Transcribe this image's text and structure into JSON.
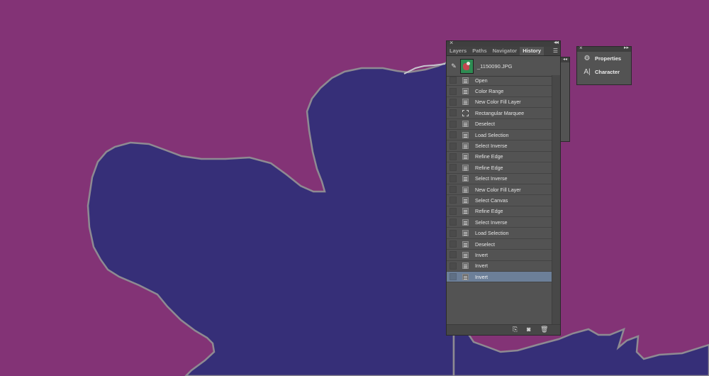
{
  "history_panel": {
    "tabs": [
      "Layers",
      "Paths",
      "Navigator",
      "History"
    ],
    "active_tab": "History",
    "snapshot_name": "_1150090.JPG",
    "items": [
      {
        "label": "Open",
        "icon": "history-state-icon"
      },
      {
        "label": "Color Range",
        "icon": "history-state-icon"
      },
      {
        "label": "New Color Fill Layer",
        "icon": "history-state-icon"
      },
      {
        "label": "Rectangular Marquee",
        "icon": "marquee-icon"
      },
      {
        "label": "Deselect",
        "icon": "history-state-icon"
      },
      {
        "label": "Load Selection",
        "icon": "history-state-icon"
      },
      {
        "label": "Select Inverse",
        "icon": "history-state-icon"
      },
      {
        "label": "Refine Edge",
        "icon": "history-state-icon"
      },
      {
        "label": "Refine Edge",
        "icon": "history-state-icon"
      },
      {
        "label": "Select Inverse",
        "icon": "history-state-icon"
      },
      {
        "label": "New Color Fill Layer",
        "icon": "history-state-icon"
      },
      {
        "label": "Select Canvas",
        "icon": "history-state-icon"
      },
      {
        "label": "Refine Edge",
        "icon": "history-state-icon"
      },
      {
        "label": "Select Inverse",
        "icon": "history-state-icon"
      },
      {
        "label": "Load Selection",
        "icon": "history-state-icon"
      },
      {
        "label": "Deselect",
        "icon": "history-state-icon"
      },
      {
        "label": "Invert",
        "icon": "history-state-icon"
      },
      {
        "label": "Invert",
        "icon": "history-state-icon"
      },
      {
        "label": "Invert",
        "icon": "history-state-icon"
      }
    ],
    "selected_index": 18,
    "footer_icons": [
      "new-document-from-state-icon",
      "camera-icon",
      "trash-icon"
    ]
  },
  "side_dock": {
    "items": [
      {
        "label": "Properties",
        "icon": "properties-icon"
      },
      {
        "label": "Character",
        "icon": "character-icon"
      }
    ]
  },
  "colors": {
    "canvas_background": "#833376",
    "shape_fill": "#362f78",
    "shape_edge": "#8e8a92",
    "panel_bg": "#535353",
    "selected_row": "#6c7f98"
  }
}
